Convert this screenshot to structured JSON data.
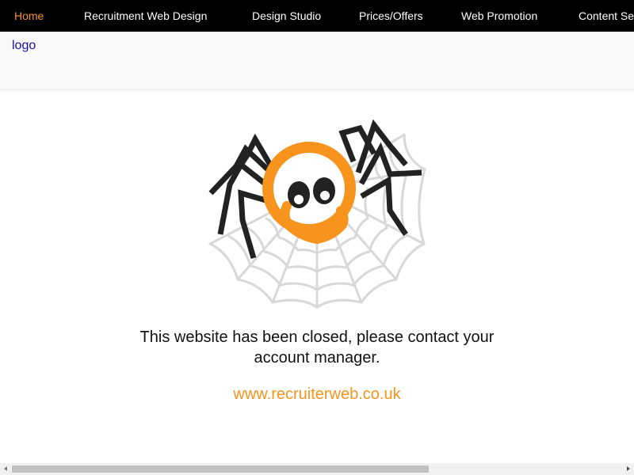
{
  "nav": {
    "items": [
      {
        "label": "Home",
        "active": true
      },
      {
        "label": "Recruitment Web Design",
        "active": false
      },
      {
        "label": "Design Studio",
        "active": false
      },
      {
        "label": "Prices/Offers",
        "active": false
      },
      {
        "label": "Web Promotion",
        "active": false
      },
      {
        "label": "Content Se",
        "active": false
      }
    ]
  },
  "header": {
    "logo_alt": "logo"
  },
  "main": {
    "illustration_icon": "spider-on-web-icon",
    "message": "This website has been closed, please contact your account manager.",
    "link_text": "www.recruiterweb.co.uk"
  },
  "colors": {
    "nav_bg": "#000000",
    "nav_text": "#ffffff",
    "accent": "#f7941e",
    "header_bg": "#f9f9f9",
    "spider_legs": "#222222",
    "web": "#d8d8d8"
  }
}
